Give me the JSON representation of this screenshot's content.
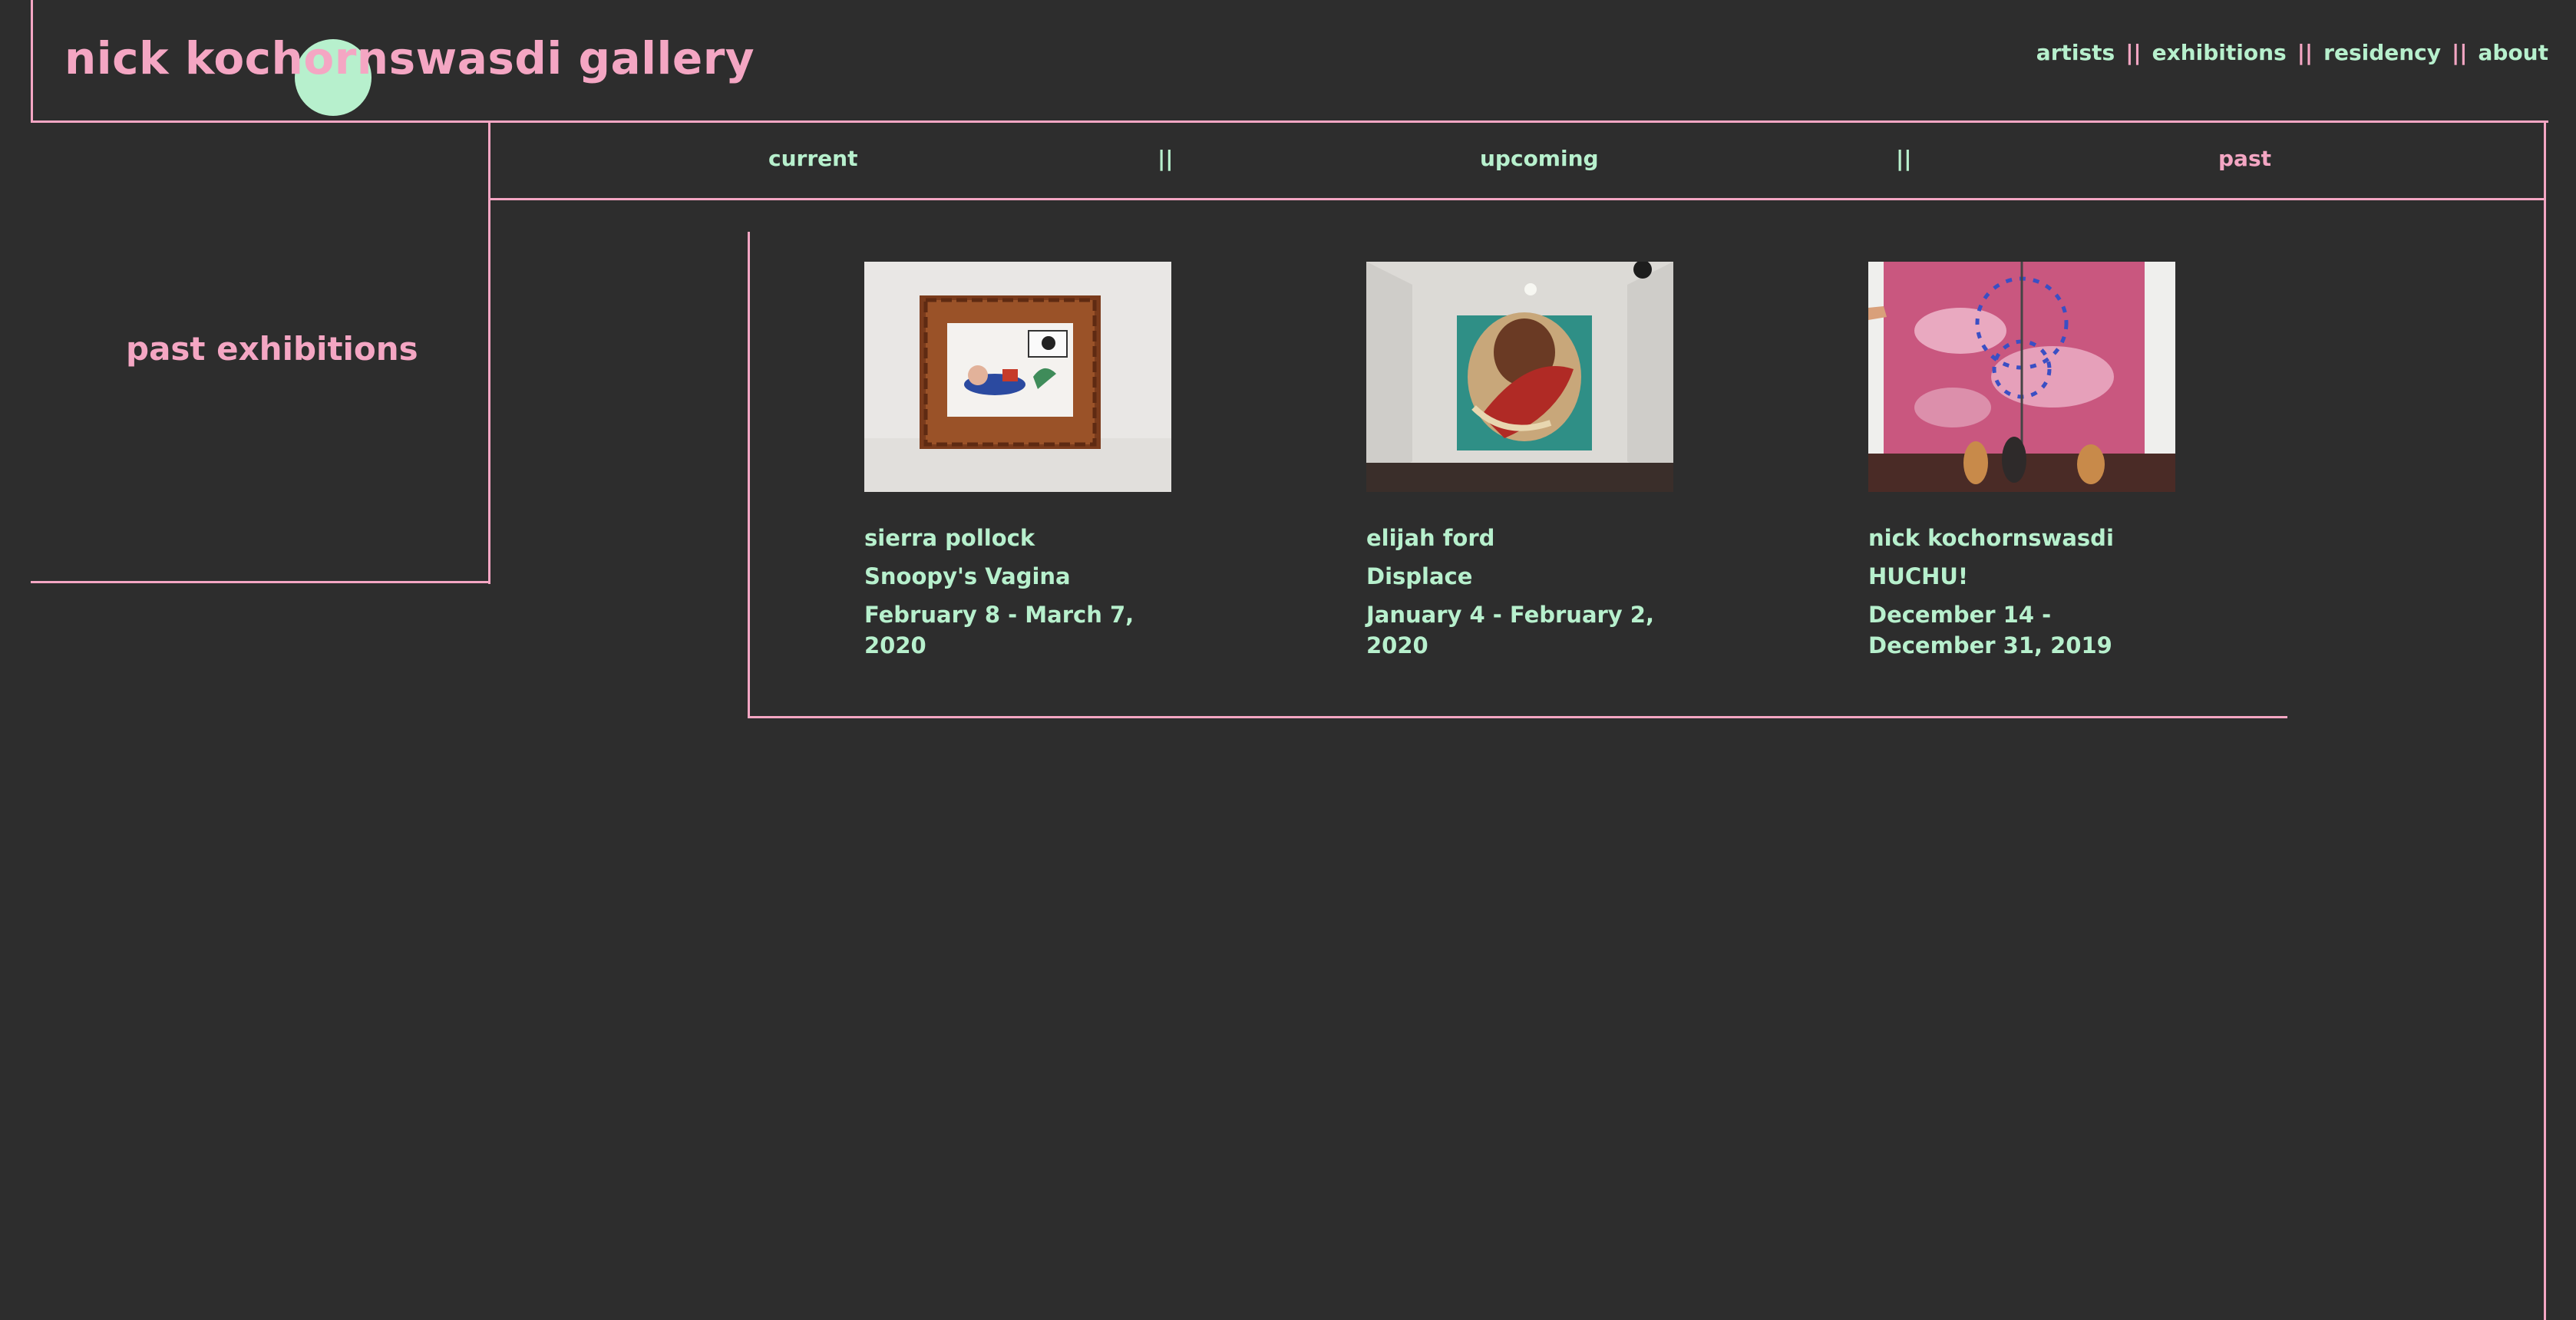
{
  "header": {
    "logo": "nick kochornswasdi gallery",
    "nav": [
      "artists",
      "exhibitions",
      "residency",
      "about"
    ],
    "nav_separator": "||"
  },
  "subnav": {
    "items": [
      "current",
      "upcoming",
      "past"
    ],
    "separator": "||",
    "active": "past"
  },
  "sidebar": {
    "title": "past exhibitions"
  },
  "exhibitions": [
    {
      "artist": "sierra pollock",
      "title": "Snoopy's Vagina",
      "dates": "February 8 - March 7, 2020"
    },
    {
      "artist": "elijah ford",
      "title": "Displace",
      "dates": "January 4 - February 2, 2020"
    },
    {
      "artist": "nick kochornswasdi",
      "title": "HUCHU!",
      "dates": "December 14 - December 31, 2019"
    }
  ],
  "colors": {
    "background": "#2d2d2d",
    "pink": "#f4a6c3",
    "mint": "#b7f0cd"
  }
}
